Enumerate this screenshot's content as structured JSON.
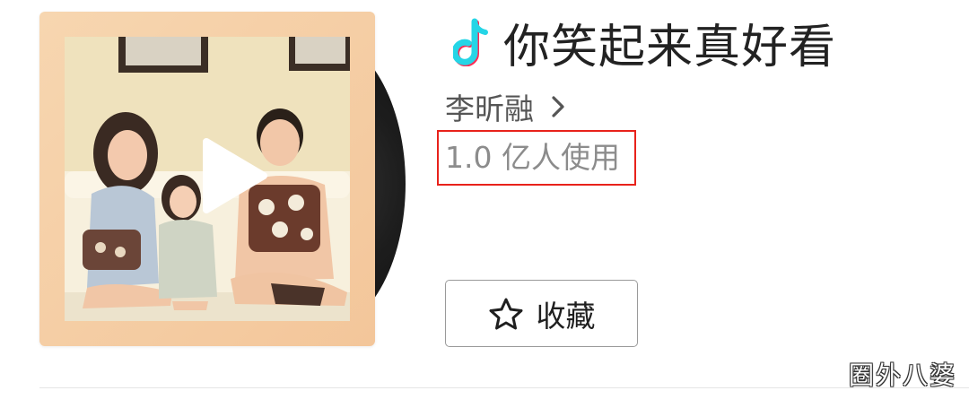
{
  "song": {
    "title": "你笑起来真好看",
    "app_icon": "tiktok-note-icon",
    "artist": "李昕融",
    "usage": "1.0 亿人使用",
    "favorite_label": "收藏",
    "favorite_icon": "star-outline-icon"
  },
  "cover": {
    "play_icon": "play-icon",
    "vinyl_icon": "vinyl-record-icon"
  },
  "colors": {
    "highlight_box": "#e8221b",
    "tiktok_cyan": "#25d5e6",
    "tiktok_red": "#fe2c55",
    "cover_bg": "#f6cfa6"
  },
  "watermark": "圈外八婆"
}
